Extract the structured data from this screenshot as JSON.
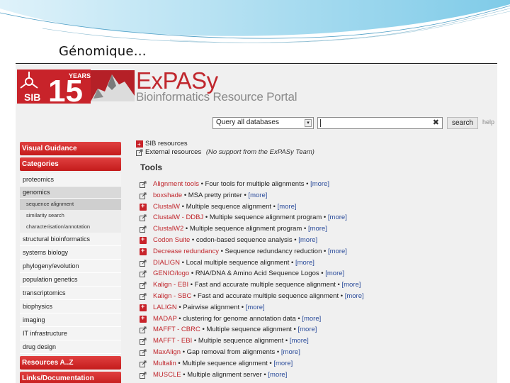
{
  "slide": {
    "title": "Génomique…"
  },
  "brand": {
    "sib_text": "SIB",
    "years_digits": "15",
    "years_label": "YEARS",
    "name": "ExPASy",
    "tagline": "Bioinformatics Resource Portal",
    "accent_color": "#c0272d"
  },
  "search": {
    "db_value": "Query all databases",
    "db_arrow": "▾",
    "clear_glyph": "✖",
    "button_label": "search",
    "help_label": "help"
  },
  "sidebar": {
    "visual_guidance": "Visual Guidance",
    "categories": "Categories",
    "items": [
      {
        "label": "proteomics"
      },
      {
        "label": "genomics"
      },
      {
        "label": "sequence alignment"
      },
      {
        "label": "similarity search"
      },
      {
        "label": "characterisation/annotation"
      },
      {
        "label": "structural bioinformatics"
      },
      {
        "label": "systems biology"
      },
      {
        "label": "phylogeny/evolution"
      },
      {
        "label": "population genetics"
      },
      {
        "label": "transcriptomics"
      },
      {
        "label": "biophysics"
      },
      {
        "label": "imaging"
      },
      {
        "label": "IT infrastructure"
      },
      {
        "label": "drug design"
      }
    ],
    "resources_az": "Resources A..Z",
    "links_documentation": "Links/Documentation"
  },
  "main": {
    "sib_resources": "SIB resources",
    "external_resources": "External resources",
    "external_note": "(No support from the ExPASy Team)",
    "tools_heading": "Tools",
    "more_label": "[more]",
    "tools": [
      {
        "name": "Alignment tools",
        "desc": " • Four tools for multiple alignments • ",
        "icon": "external"
      },
      {
        "name": "boxshade",
        "desc": " • MSA pretty printer • ",
        "icon": "external"
      },
      {
        "name": "ClustalW",
        "desc": " • Multiple sequence alignment • ",
        "icon": "sib"
      },
      {
        "name": "ClustalW - DDBJ",
        "desc": " • Multiple sequence alignment program • ",
        "icon": "external"
      },
      {
        "name": "ClustalW2",
        "desc": " • Multiple sequence alignment program • ",
        "icon": "external"
      },
      {
        "name": "Codon Suite",
        "desc": " • codon-based sequence analysis • ",
        "icon": "sib"
      },
      {
        "name": "Decrease redundancy",
        "desc": " • Sequence redundancy reduction • ",
        "icon": "sib"
      },
      {
        "name": "DIALIGN",
        "desc": " • Local multiple sequence alignment • ",
        "icon": "external"
      },
      {
        "name": "GENIO/logo",
        "desc": " • RNA/DNA & Amino Acid Sequence Logos • ",
        "icon": "external"
      },
      {
        "name": "Kalign - EBI",
        "desc": " • Fast and accurate multiple sequence alignment • ",
        "icon": "external"
      },
      {
        "name": "Kalign - SBC",
        "desc": " • Fast and accurate multiple sequence alignment • ",
        "icon": "external"
      },
      {
        "name": "LALIGN",
        "desc": " • Pairwise alignment • ",
        "icon": "sib"
      },
      {
        "name": "MADAP",
        "desc": " • clustering for genome annotation data • ",
        "icon": "sib"
      },
      {
        "name": "MAFFT - CBRC",
        "desc": " • Multiple sequence alignment • ",
        "icon": "external"
      },
      {
        "name": "MAFFT - EBI",
        "desc": " • Multiple sequence alignment • ",
        "icon": "external"
      },
      {
        "name": "MaxAlign",
        "desc": " • Gap removal from alignments • ",
        "icon": "external"
      },
      {
        "name": "Multalin",
        "desc": " • Multiple sequence alignment • ",
        "icon": "external"
      },
      {
        "name": "MUSCLE",
        "desc": " • Multiple alignment server • ",
        "icon": "external"
      }
    ]
  }
}
